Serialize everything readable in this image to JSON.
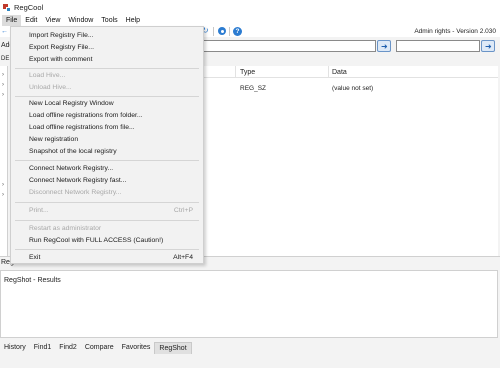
{
  "window": {
    "title": "RegCool",
    "admin_info": "Admin rights - Version 2.030"
  },
  "menubar": {
    "items": [
      "File",
      "Edit",
      "View",
      "Window",
      "Tools",
      "Help"
    ]
  },
  "address": {
    "label": "Add",
    "left_tab": "DE"
  },
  "list": {
    "columns": [
      "Type",
      "Data"
    ],
    "rows": [
      {
        "type": "REG_SZ",
        "data": "(value not set)"
      }
    ]
  },
  "regshot": {
    "panel_label": "Regshot",
    "results_text": "RegShot - Results"
  },
  "bottom_tabs": {
    "items": [
      "History",
      "Find1",
      "Find2",
      "Compare",
      "Favorites",
      "RegShot"
    ],
    "active": "RegShot"
  },
  "file_menu": {
    "items": [
      {
        "label": "Import Registry File...",
        "disabled": false
      },
      {
        "label": "Export Registry File...",
        "disabled": false
      },
      {
        "label": "Export with comment",
        "disabled": false
      },
      {
        "label": "Load Hive...",
        "disabled": true
      },
      {
        "label": "Unload Hive...",
        "disabled": true
      },
      {
        "label": "New Local Registry Window",
        "disabled": false
      },
      {
        "label": "Load offline registrations from folder...",
        "disabled": false
      },
      {
        "label": "Load offline registrations from file...",
        "disabled": false
      },
      {
        "label": "New registration",
        "disabled": false
      },
      {
        "label": "Snapshot of the local registry",
        "disabled": false
      },
      {
        "label": "Connect Network Registry...",
        "disabled": false
      },
      {
        "label": "Connect Network Registry fast...",
        "disabled": false
      },
      {
        "label": "Disconnect Network Registry...",
        "disabled": true
      },
      {
        "label": "Print...",
        "disabled": true,
        "shortcut": "Ctrl+P"
      },
      {
        "label": "Restart as administrator",
        "disabled": true
      },
      {
        "label": "Run RegCool with FULL ACCESS (Caution!)",
        "disabled": false
      },
      {
        "label": "Exit",
        "disabled": false,
        "shortcut": "Alt+F4"
      }
    ]
  },
  "icons": {
    "refresh": "refresh-icon",
    "settings": "gear-icon",
    "help": "help-icon",
    "go": "go-arrow-icon",
    "search": "search-icon"
  },
  "colors": {
    "accent": "#2c7cd1"
  }
}
